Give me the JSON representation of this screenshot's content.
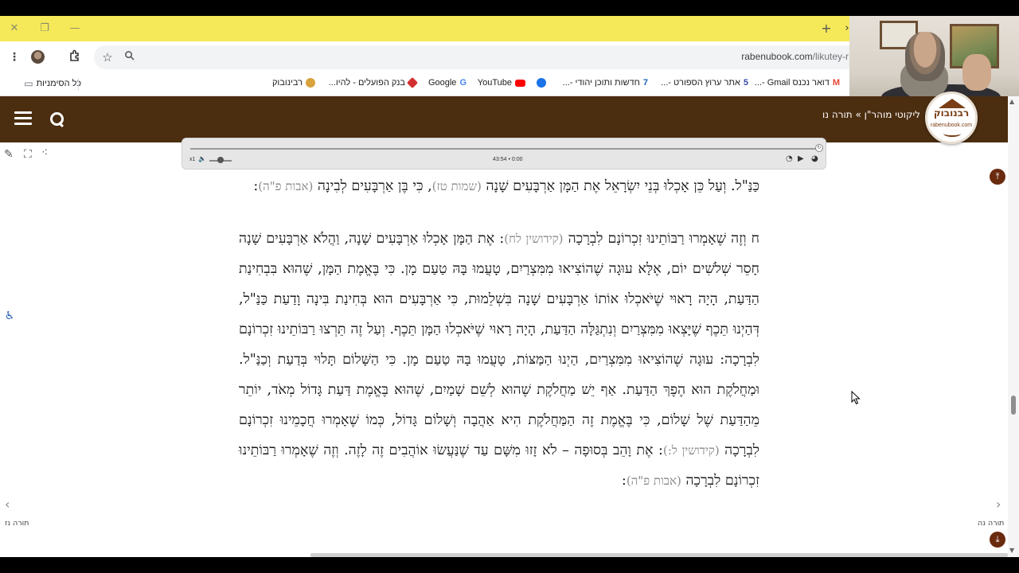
{
  "browser": {
    "url_host": "rabenubook.com",
    "url_path": "/likutey-r",
    "window_controls": {
      "close": "✕",
      "restore": "❐",
      "minimize": "—"
    },
    "new_tab": "+",
    "bookmarks": [
      {
        "label": "כל הסימניות",
        "color": "#5f6368"
      },
      {
        "label": "רבינובוק",
        "color": "#d8a23c"
      },
      {
        "label": "בנק הפועלים - להיו...",
        "color": "#d32f2f"
      },
      {
        "label": "Google",
        "color": "#4285f4"
      },
      {
        "label": "YouTube",
        "color": "#ff0000"
      },
      {
        "label": "",
        "color": "#1a73e8"
      },
      {
        "label": "חדשות ותוכן יהודי -...",
        "color": "#1565c0"
      },
      {
        "label": "אתר ערוץ הספורט -...",
        "color": "#3949ab"
      },
      {
        "label": "דואר נכנס Gmail -...",
        "color": "#ea4335"
      }
    ]
  },
  "site": {
    "breadcrumb": "ליקוטי מוהר\"ן » תורה נו",
    "logo_title": "רבנובוק",
    "logo_sub": "rabenubook.com",
    "accent": "#4b2d10"
  },
  "player": {
    "speed": "x1",
    "time": "43:54 • 0:00"
  },
  "content": {
    "p1": {
      "t1": "כַּנַּ\"ל. וְעַל כֵּן אָכְלוּ בְּנֵי יִשְׂרָאֵל אֶת הַמָּן אַרְבָּעִים שָׁנָה",
      "r1": "(שמות טז)",
      "t2": ", כִּי בֶּן אַרְבָּעִים לְבִינָה",
      "r2": "(אבות פ\"ה)",
      "t3": ":"
    },
    "p2": {
      "t1": "ח וְזֶה שֶׁאָמְרוּ רַבּוֹתֵינוּ זִכְרוֹנָם לִבְרָכָה",
      "r1": "(קידושין לח)",
      "t2": ": אֶת הַמָּן אָכְלוּ אַרְבָּעִים שָׁנָה, וַהֲלֹא אַרְבָּעִים שָׁנָה חָסֵר שְׁלֹשִׁים יוֹם, אֶלָּא עוּגָה שֶׁהוֹצִיאוּ מִמִּצְרַיִם, טָעֲמוּ בָּהּ טַעַם מָן. כִּי בֶּאֱמֶת הַמָּן, שֶׁהוּא בִּבְחִינַת הַדַּעַת, הָיָה רָאוּי שֶׁיֹּאכְלוּ אוֹתוֹ אַרְבָּעִים שָׁנָה בִּשְׁלֵמוּת, כִּי אַרְבָּעִים הוּא בְּחִינַת בִּינָה וָדַעַת כַּנַּ\"ל, דְּהַיְנוּ תֵּכֶף שֶׁיָּצְאוּ מִמִּצְרַיִם וְנִתְגַּלָּה הַדַּעַת, הָיָה רָאוּי שֶׁיֹּאכְלוּ הַמָּן תֵּכֶף. וְעַל זֶה תֵּרְצוּ רַבּוֹתֵינוּ זִכְרוֹנָם לִבְרָכָה: עוּגָה שֶׁהוֹצִיאוּ מִמִּצְרַיִם, הַיְנוּ הַמַּצּוֹת, טָעֲמוּ בָּהּ טַעַם מָן. כִּי הַשָּׁלוֹם תָּלוּי בְּדַעַת וְכַנַּ\"ל. וּמַחֲלֹקֶת הוּא הֶפֶךְ הַדַּעַת. אַף יֵשׁ מַחֲלֹקֶת שֶׁהוּא לְשֵׁם שָׁמַיִם, שֶׁהוּא בֶּאֱמֶת דַּעַת גָּדוֹל מְאֹד, יוֹתֵר מֵהַדַּעַת שֶׁל שָׁלוֹם, כִּי בֶּאֱמֶת זֶה הַמַּחֲלֹקֶת הִיא אַהֲבָה וְשָׁלוֹם גָּדוֹל, כְּמוֹ שֶׁאָמְרוּ חֲכָמֵינוּ זִכְרוֹנָם לִבְרָכָה",
      "r2": "(קידושין ל:)",
      "t3": ": אֶת וָהֵב בְּסוּפָה – לֹא זָזוּ מִשָּׁם עַד שֶׁנַּעֲשׂוּ אוֹהֲבִים זֶה לָזֶה. וְזֶה שֶׁאָמְרוּ רַבּוֹתֵינוּ זִכְרוֹנָם לִבְרָכָה",
      "r3": "(אבות פ\"ה)",
      "t4": ":"
    }
  },
  "nav": {
    "next_label": "תורה נה",
    "prev_label": "תורה נז",
    "next_arrow": "›",
    "prev_arrow": "‹",
    "top_arrow": "⤒",
    "bottom_arrow": "⤓"
  }
}
